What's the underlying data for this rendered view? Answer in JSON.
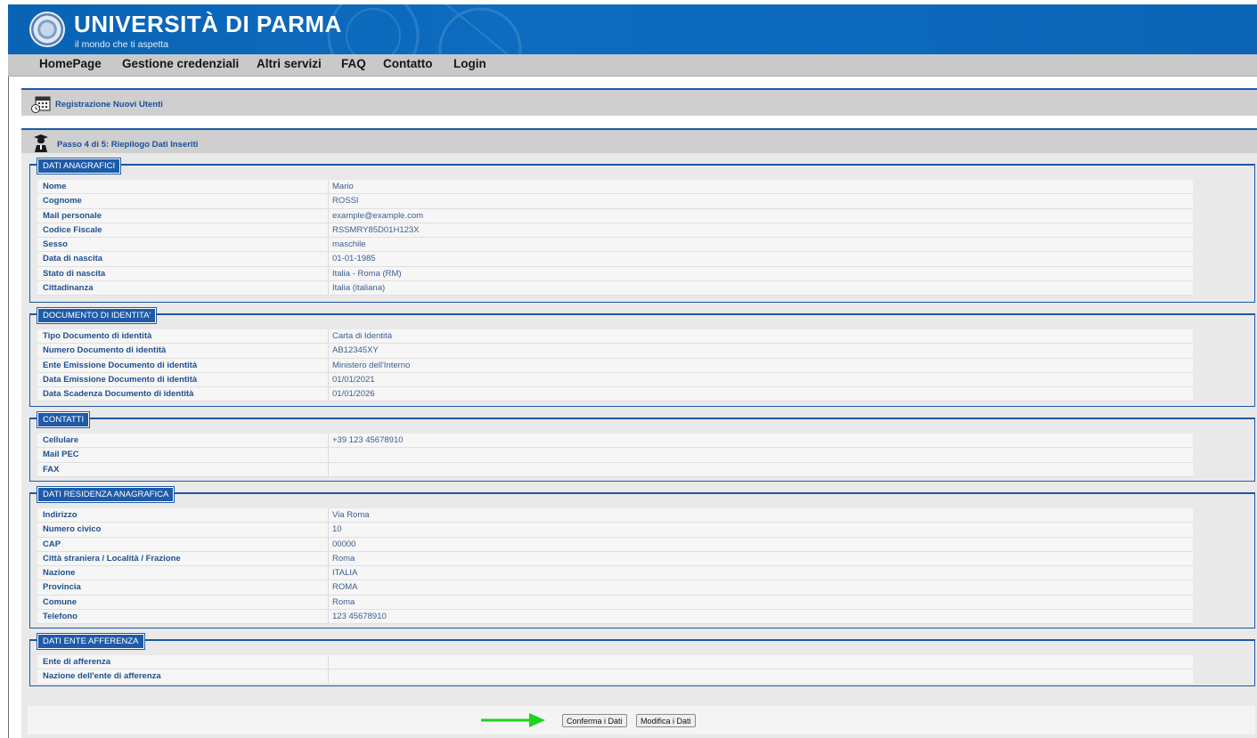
{
  "header": {
    "title": "UNIVERSITÀ DI PARMA",
    "subtitle": "il mondo che ti aspetta"
  },
  "nav": [
    "HomePage",
    "Gestione credenziali",
    "Altri servizi",
    "FAQ",
    "Contatto",
    "Login"
  ],
  "page_header": "Registrazione Nuovi Utenti",
  "step_header": "Passo 4 di 5: Riepilogo Dati Inseriti",
  "sections": {
    "anagrafici": {
      "legend": "DATI ANAGRAFICI",
      "rows": [
        {
          "label": "Nome",
          "value": "Mario"
        },
        {
          "label": "Cognome",
          "value": "ROSSI"
        },
        {
          "label": "Mail personale",
          "value": "example@example.com"
        },
        {
          "label": "Codice Fiscale",
          "value": "RSSMRY85D01H123X"
        },
        {
          "label": "Sesso",
          "value": "maschile"
        },
        {
          "label": "Data di nascita",
          "value": "01-01-1985"
        },
        {
          "label": "Stato di nascita",
          "value": "Italia - Roma (RM)"
        },
        {
          "label": "Cittadinanza",
          "value": "Italia (italiana)"
        }
      ]
    },
    "documento": {
      "legend": "DOCUMENTO DI IDENTITA'",
      "rows": [
        {
          "label": "Tipo Documento di identità",
          "value": "Carta di Identità"
        },
        {
          "label": "Numero Documento di identità",
          "value": "AB12345XY"
        },
        {
          "label": "Ente Emissione Documento di identità",
          "value": "Ministero dell'Interno"
        },
        {
          "label": "Data Emissione Documento di identità",
          "value": "01/01/2021"
        },
        {
          "label": "Data Scadenza Documento di identità",
          "value": "01/01/2026"
        }
      ]
    },
    "contatti": {
      "legend": "CONTATTI",
      "rows": [
        {
          "label": "Cellulare",
          "value": "+39 123 45678910"
        },
        {
          "label": "Mail PEC",
          "value": ""
        },
        {
          "label": "FAX",
          "value": ""
        }
      ]
    },
    "residenza": {
      "legend": "DATI RESIDENZA ANAGRAFICA",
      "rows": [
        {
          "label": "Indirizzo",
          "value": "Via Roma"
        },
        {
          "label": "Numero civico",
          "value": "10"
        },
        {
          "label": "CAP",
          "value": "00000"
        },
        {
          "label": "Città straniera / Località / Frazione",
          "value": "Roma"
        },
        {
          "label": "Nazione",
          "value": "ITALIA"
        },
        {
          "label": "Provincia",
          "value": "ROMA"
        },
        {
          "label": "Comune",
          "value": "Roma"
        },
        {
          "label": "Telefono",
          "value": "123 45678910"
        }
      ]
    },
    "ente": {
      "legend": "DATI ENTE AFFERENZA",
      "rows": [
        {
          "label": "Ente di afferenza",
          "value": ""
        },
        {
          "label": "Nazione dell'ente di afferenza",
          "value": ""
        }
      ]
    }
  },
  "buttons": {
    "confirm": "Conferma i Dati",
    "modify": "Modifica i Dati"
  },
  "colors": {
    "brand_blue": "#0b64b6",
    "section_blue": "#1e5aa8",
    "arrow_green": "#1fd21f"
  }
}
